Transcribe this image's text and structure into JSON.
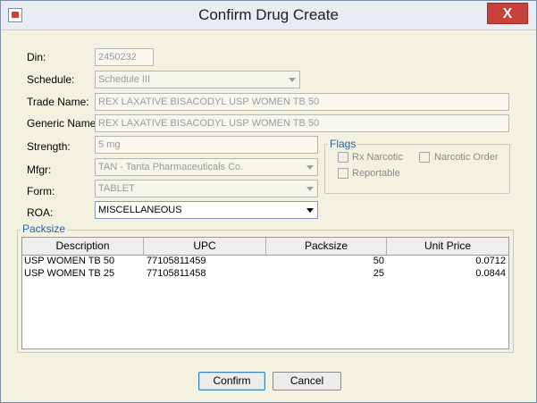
{
  "window": {
    "title": "Confirm Drug Create",
    "close_label": "X"
  },
  "form": {
    "din_label": "Din:",
    "din_value": "2450232",
    "schedule_label": "Schedule:",
    "schedule_value": "Schedule III",
    "trade_name_label": "Trade Name:",
    "trade_name_value": "REX LAXATIVE BISACODYL USP WOMEN TB 50",
    "generic_name_label": "Generic Name:",
    "generic_name_value": "REX LAXATIVE BISACODYL USP WOMEN TB 50",
    "strength_label": "Strength:",
    "strength_value": "5 mg",
    "mfgr_label": "Mfgr:",
    "mfgr_value": "TAN - Tanta Pharmaceuticals Co.",
    "form_label": "Form:",
    "form_value": "TABLET",
    "roa_label": "ROA:",
    "roa_value": "MISCELLANEOUS"
  },
  "flags": {
    "title": "Flags",
    "rx_narcotic": "Rx Narcotic",
    "narcotic_order": "Narcotic Order",
    "reportable": "Reportable"
  },
  "packsize": {
    "title": "Packsize",
    "columns": [
      "Description",
      "UPC",
      "Packsize",
      "Unit Price"
    ],
    "rows": [
      {
        "description": "USP WOMEN TB 50",
        "upc": "77105811459",
        "packsize": "50",
        "unit_price": "0.0712"
      },
      {
        "description": "USP WOMEN TB 25",
        "upc": "77105811458",
        "packsize": "25",
        "unit_price": "0.0844"
      }
    ]
  },
  "buttons": {
    "confirm": "Confirm",
    "cancel": "Cancel"
  }
}
